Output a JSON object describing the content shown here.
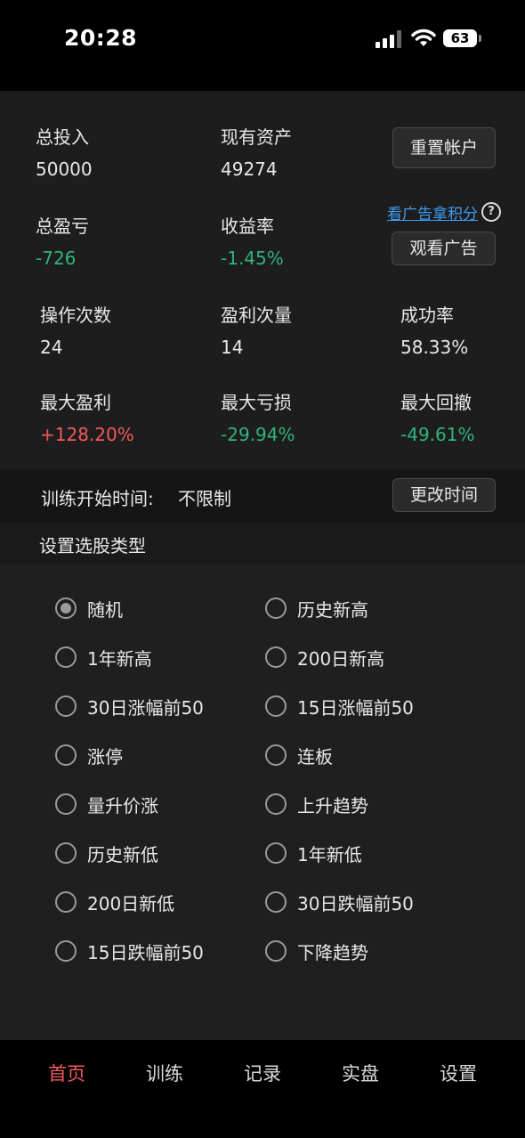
{
  "status_bar": {
    "time": "20:28",
    "battery": "63"
  },
  "account": {
    "total_investment_label": "总投入",
    "total_investment_value": "50000",
    "current_assets_label": "现有资产",
    "current_assets_value": "49274",
    "reset_button": "重置帐户",
    "total_pnl_label": "总盈亏",
    "total_pnl_value": "-726",
    "return_rate_label": "收益率",
    "return_rate_value": "-1.45%",
    "ad_link": "看广告拿积分",
    "help_icon": "?",
    "watch_ad_button": "观看广告"
  },
  "stats": {
    "operations_label": "操作次数",
    "operations_value": "24",
    "profit_count_label": "盈利次量",
    "profit_count_value": "14",
    "success_rate_label": "成功率",
    "success_rate_value": "58.33%",
    "max_profit_label": "最大盈利",
    "max_profit_value": "+128.20%",
    "max_loss_label": "最大亏损",
    "max_loss_value": "-29.94%",
    "max_drawdown_label": "最大回撤",
    "max_drawdown_value": "-49.61%"
  },
  "training": {
    "start_time_label": "训练开始时间:",
    "start_time_value": "不限制",
    "change_time_button": "更改时间"
  },
  "stock_type": {
    "title": "设置选股类型",
    "selected": "随机",
    "options": [
      "随机",
      "历史新高",
      "1年新高",
      "200日新高",
      "30日涨幅前50",
      "15日涨幅前50",
      "涨停",
      "连板",
      "量升价涨",
      "上升趋势",
      "历史新低",
      "1年新低",
      "200日新低",
      "30日跌幅前50",
      "15日跌幅前50",
      "下降趋势"
    ]
  },
  "tabs": [
    "首页",
    "训练",
    "记录",
    "实盘",
    "设置"
  ],
  "active_tab": "首页",
  "colors": {
    "negative": "#2fb47c",
    "positive": "#f05a5a",
    "link": "#3d9cf0"
  }
}
